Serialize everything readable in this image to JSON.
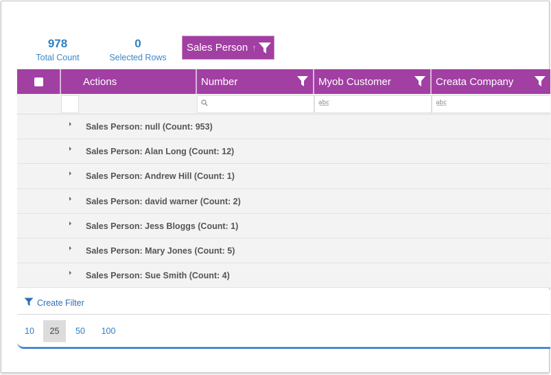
{
  "stats": {
    "total_count": "978",
    "total_count_label": "Total Count",
    "selected_rows": "0",
    "selected_rows_label": "Selected Rows"
  },
  "group_chip": {
    "label": "Sales Person",
    "sort_arrow": "↑",
    "icon": "filter-icon"
  },
  "columns": [
    {
      "label": "Actions"
    },
    {
      "label": "Number"
    },
    {
      "label": "Myob Customer"
    },
    {
      "label": "Creata Company"
    }
  ],
  "filter_row": {
    "number_icon": "search-icon",
    "text_icon_glyph": "a͟b͟c"
  },
  "groups": [
    {
      "label": "Sales Person: null (Count: 953)"
    },
    {
      "label": "Sales Person: Alan Long (Count: 12)"
    },
    {
      "label": "Sales Person: Andrew Hill (Count: 1)"
    },
    {
      "label": "Sales Person: david warner (Count: 2)"
    },
    {
      "label": "Sales Person: Jess Bloggs (Count: 1)"
    },
    {
      "label": "Sales Person: Mary Jones (Count: 5)"
    },
    {
      "label": "Sales Person: Sue Smith (Count: 4)"
    }
  ],
  "footer": {
    "create_filter_label": "Create Filter"
  },
  "pager": {
    "sizes": [
      "10",
      "25",
      "50",
      "100"
    ],
    "active": "25"
  },
  "colors": {
    "header_bg": "#a23fa3",
    "accent_blue": "#2d7ec4"
  }
}
